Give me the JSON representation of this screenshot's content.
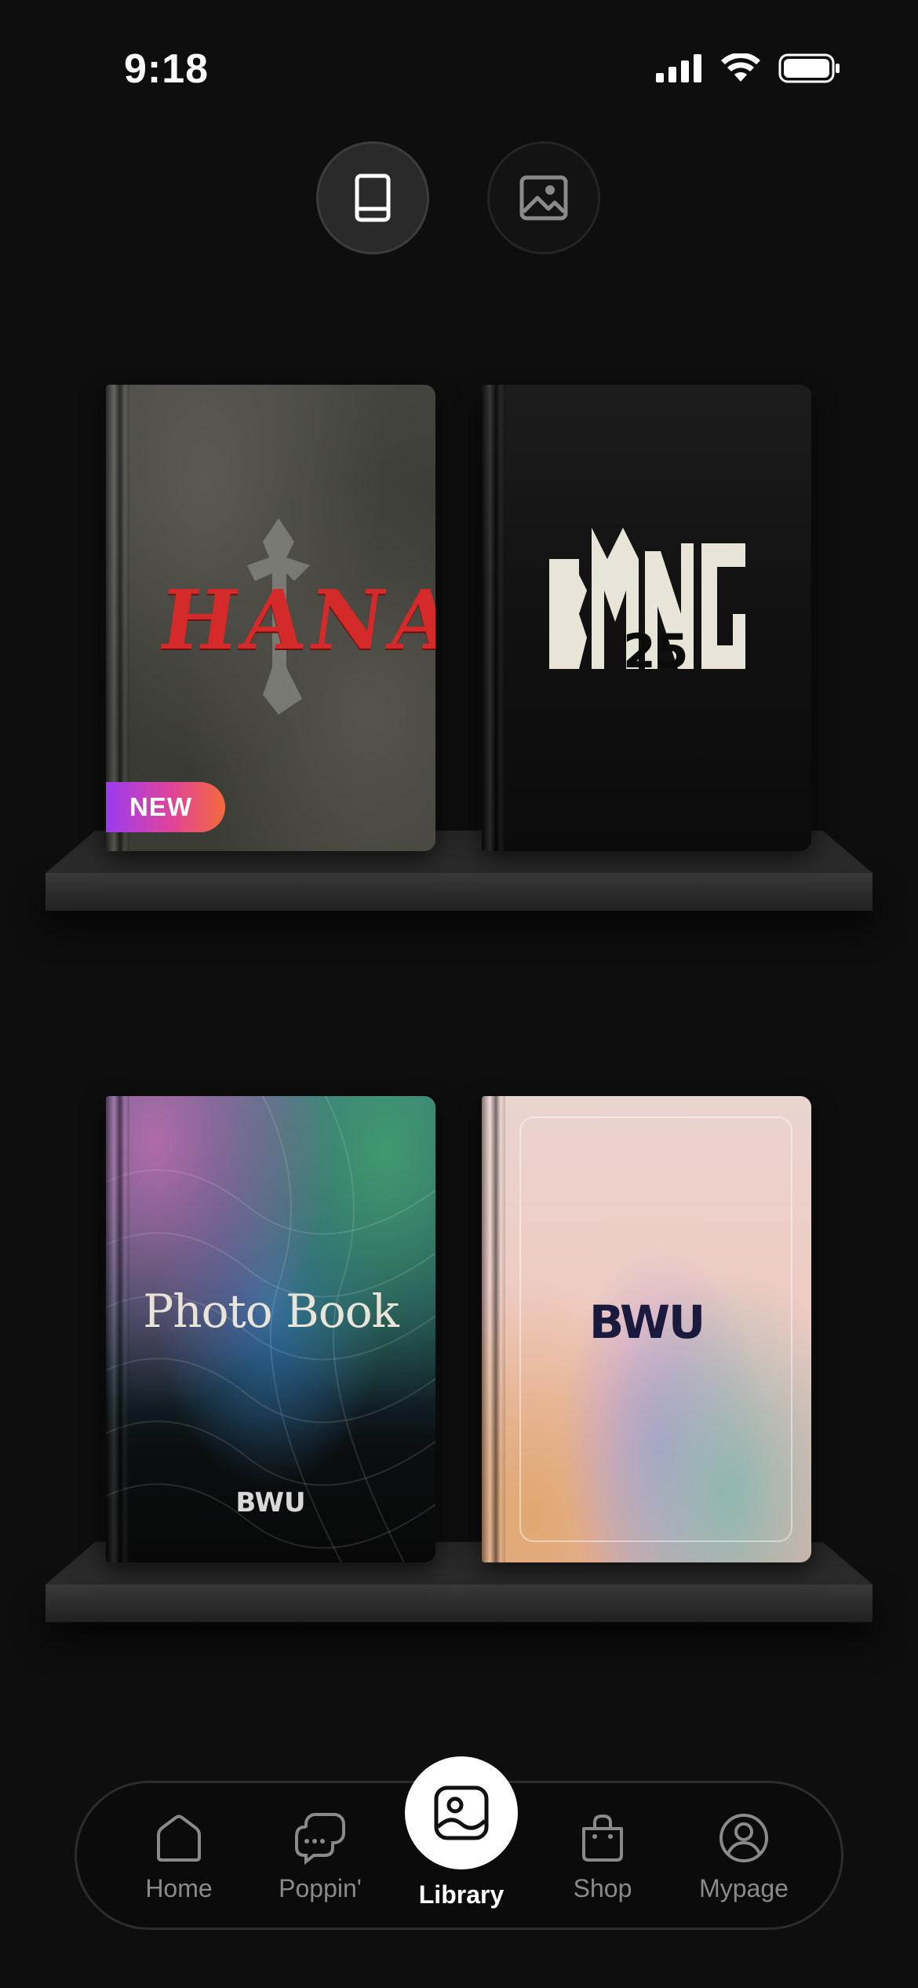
{
  "status_bar": {
    "time": "9:18"
  },
  "view_toggle": {
    "active": "book-view",
    "options": [
      "book-icon",
      "image-icon"
    ]
  },
  "shelves": [
    {
      "books": [
        {
          "title": "HANA",
          "badge": "NEW"
        },
        {
          "title": "BMNG"
        }
      ]
    },
    {
      "books": [
        {
          "title": "Photo Book",
          "brand": "BWU"
        },
        {
          "title": "BWU"
        }
      ]
    }
  ],
  "tab_bar": {
    "tabs": [
      {
        "label": "Home",
        "icon": "home-icon"
      },
      {
        "label": "Poppin'",
        "icon": "chat-icon"
      },
      {
        "label": "Library",
        "icon": "library-icon",
        "active": true
      },
      {
        "label": "Shop",
        "icon": "bag-icon"
      },
      {
        "label": "Mypage",
        "icon": "user-icon"
      }
    ]
  },
  "colors": {
    "background": "#0e0e0e",
    "hana_title": "#d42a2a",
    "badge_gradient_start": "#9b3cf0",
    "badge_gradient_end": "#f26a3a",
    "bwu_logo": "#1a1a3e"
  }
}
